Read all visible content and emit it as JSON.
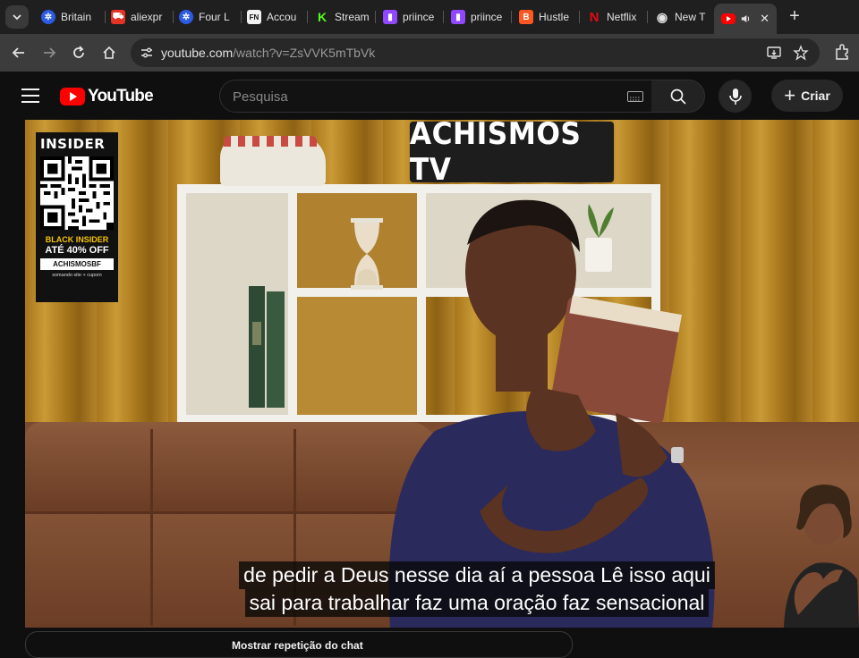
{
  "browser": {
    "tabs": [
      {
        "title": "Britain",
        "icon": "globe-blue-icon",
        "color": "#2d5be3"
      },
      {
        "title": "aliexpr",
        "icon": "cart-icon",
        "color": "#e43225"
      },
      {
        "title": "Four L",
        "icon": "globe-blue-icon",
        "color": "#2d5be3"
      },
      {
        "title": "Accou",
        "icon": "fn-icon",
        "color": "#f2f2f2"
      },
      {
        "title": "Stream",
        "icon": "kick-icon",
        "color": "#53fc18"
      },
      {
        "title": "priince",
        "icon": "twitch-icon",
        "color": "#9146ff"
      },
      {
        "title": "priince",
        "icon": "twitch-icon",
        "color": "#9146ff"
      },
      {
        "title": "Hustle",
        "icon": "blogger-icon",
        "color": "#ff5722"
      },
      {
        "title": "Netflix",
        "icon": "netflix-icon",
        "color": "#e50914"
      },
      {
        "title": "New T",
        "icon": "chrome-icon",
        "color": "#e3e3e3"
      }
    ],
    "active_tab": {
      "icon": "youtube-icon",
      "color": "#ff0000",
      "audio_icon": "speaker-icon"
    },
    "url_host": "youtube.com",
    "url_path": "/watch?v=ZsVVK5mTbVk"
  },
  "youtube": {
    "logo_text": "YouTube",
    "search_placeholder": "Pesquisa",
    "create_label": "Criar"
  },
  "video": {
    "set_sign": "ACHISMOS TV",
    "ad": {
      "brand": "INSIDER",
      "line1": "BLACK INSIDER",
      "line2": "ATÉ 40% OFF",
      "coupon": "ACHISMOSBF",
      "footnote": "somando site + cupom"
    },
    "captions": [
      "de pedir a Deus nesse dia aí a pessoa Lê isso aqui",
      "sai para trabalhar faz uma oração faz sensacional"
    ]
  },
  "chat": {
    "label": "Mostrar repetição do chat"
  },
  "colors": {
    "browser_bg": "#1f1f1f",
    "toolbar_bg": "#3c3c3c",
    "yt_bg": "#0f0f0f",
    "yt_red": "#ff0000",
    "curtain": "#b68321"
  }
}
